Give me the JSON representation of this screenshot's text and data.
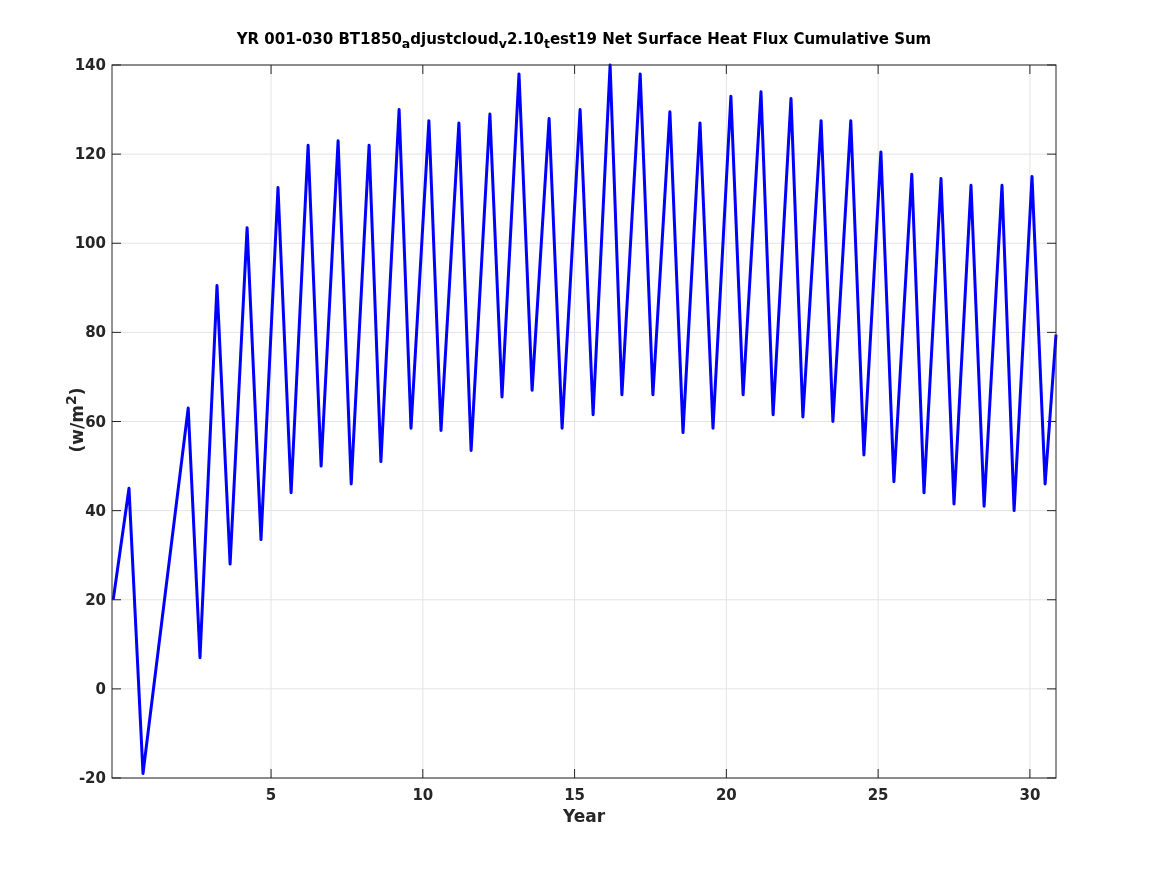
{
  "chart_data": {
    "type": "line",
    "title": "YR 001-030 BT1850$_{a}$djustcloud$_{v}$2.10$_{t}$est19 Net Surface Heat Flux  Cumulative Sum",
    "xlabel": "Year",
    "ylabel": "(w/m$^{2}$)",
    "x": [
      -0.2,
      0.32,
      0.78,
      2.27,
      2.66,
      3.22,
      3.65,
      4.21,
      4.67,
      5.23,
      5.66,
      6.22,
      6.65,
      7.21,
      7.64,
      8.23,
      8.62,
      9.22,
      9.61,
      10.2,
      10.6,
      11.19,
      11.59,
      12.21,
      12.61,
      13.17,
      13.6,
      14.16,
      14.59,
      15.18,
      15.61,
      16.17,
      16.56,
      17.16,
      17.58,
      18.14,
      18.57,
      19.13,
      19.56,
      20.15,
      20.55,
      21.14,
      21.54,
      22.13,
      22.52,
      23.12,
      23.51,
      24.1,
      24.53,
      25.09,
      25.52,
      26.11,
      26.51,
      27.07,
      27.5,
      28.06,
      28.49,
      29.08,
      29.48,
      30.07,
      30.5,
      30.86
    ],
    "series": [
      {
        "color": "#0000ff",
        "values": [
          20,
          45,
          -19,
          63,
          7,
          90.5,
          28,
          103.5,
          33.5,
          112.5,
          44,
          122,
          50,
          123,
          46,
          122,
          51,
          130,
          58.5,
          127.5,
          58,
          127,
          53.5,
          129,
          65.5,
          138,
          67,
          128,
          58.5,
          130,
          61.5,
          140,
          66,
          138,
          66,
          129.5,
          57.5,
          127,
          58.5,
          133,
          66,
          134,
          61.5,
          132.5,
          61,
          127.5,
          60,
          127.5,
          52.5,
          120.5,
          46.5,
          115.5,
          44,
          114.5,
          41.5,
          113,
          41,
          113,
          40,
          115,
          46,
          79.5
        ]
      }
    ],
    "grid": true,
    "xlim": [
      -0.24,
      30.86
    ],
    "ylim": [
      -20,
      140
    ],
    "xticks": [
      5,
      10,
      15,
      20,
      25,
      30
    ],
    "yticks": [
      -20,
      0,
      20,
      40,
      60,
      80,
      100,
      120,
      140
    ]
  }
}
